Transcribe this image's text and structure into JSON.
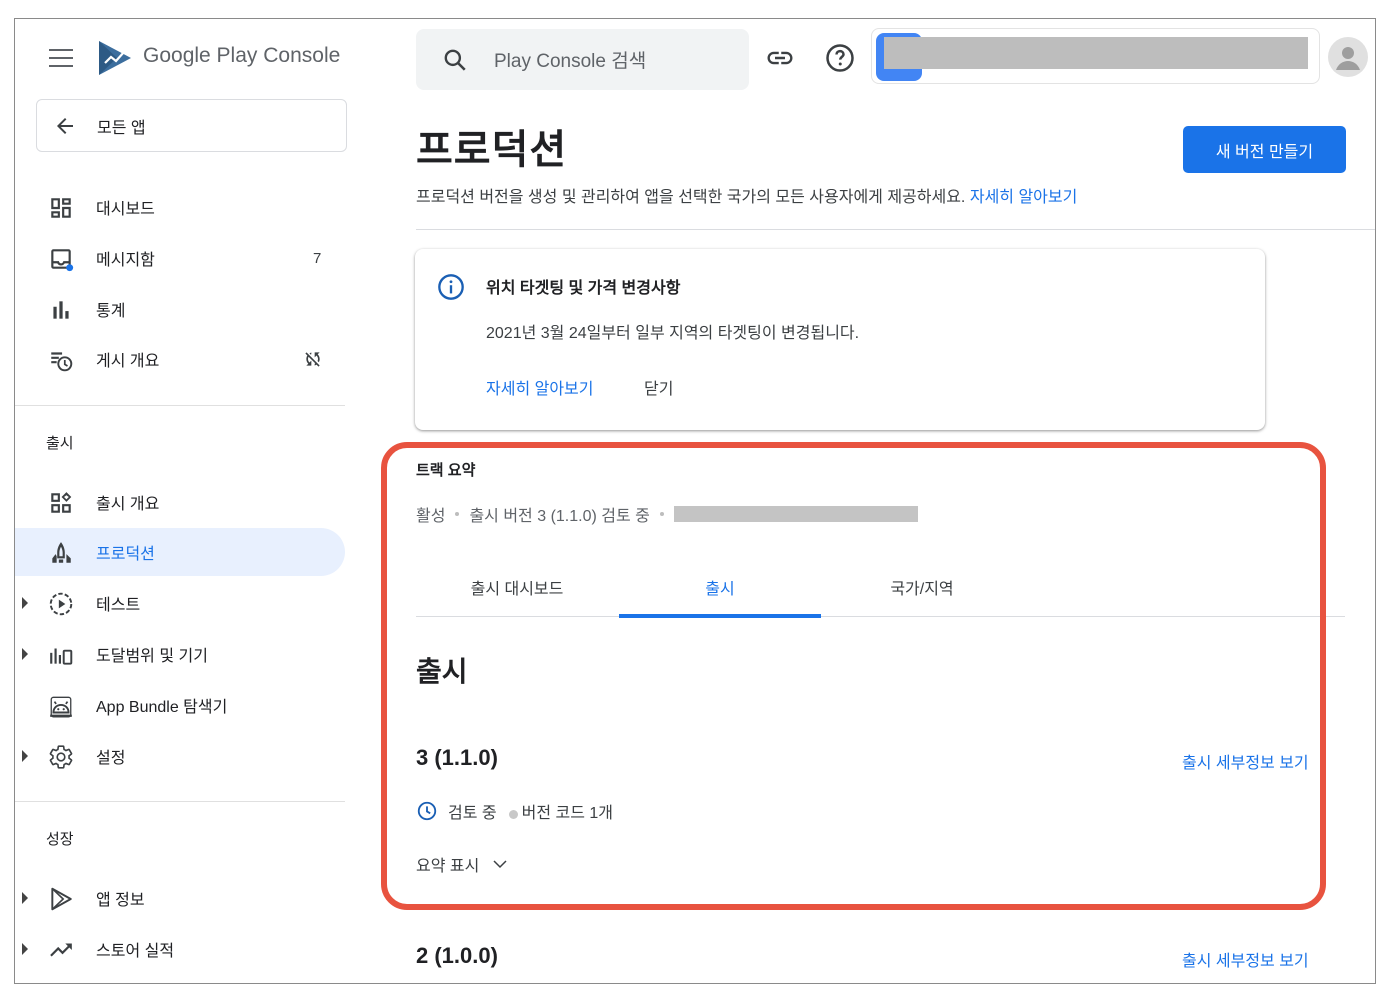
{
  "app": {
    "brand_prefix": "Google Play",
    "brand_suffix": "Console"
  },
  "sidebar": {
    "back_label": "모든 앱",
    "items": [
      {
        "label": "대시보드",
        "icon": "dashboard-icon"
      },
      {
        "label": "메시지함",
        "icon": "inbox-icon",
        "badge": "7"
      },
      {
        "label": "통계",
        "icon": "bar-chart-icon"
      },
      {
        "label": "게시 개요",
        "icon": "publishing-overview-icon",
        "status_icon": "sync-off-icon"
      }
    ],
    "release_section": "출시",
    "release_items": [
      {
        "label": "출시 개요",
        "icon": "release-overview-icon"
      },
      {
        "label": "프로덕션",
        "icon": "rocket-icon",
        "active": true
      },
      {
        "label": "테스트",
        "icon": "play-circle-icon",
        "expandable": true
      },
      {
        "label": "도달범위 및 기기",
        "icon": "devices-chart-icon",
        "expandable": true
      },
      {
        "label": "App Bundle 탐색기",
        "icon": "android-icon"
      },
      {
        "label": "설정",
        "icon": "gear-icon",
        "expandable": true
      }
    ],
    "growth_section": "성장",
    "growth_items": [
      {
        "label": "앱 정보",
        "icon": "play-store-icon",
        "expandable": true
      },
      {
        "label": "스토어 실적",
        "icon": "trending-up-icon",
        "expandable": true
      }
    ]
  },
  "topbar": {
    "search_placeholder": "Play Console 검색",
    "link_icon": "link-icon",
    "help_icon": "help-icon"
  },
  "main": {
    "title": "프로덕션",
    "create_button": "새 버전 만들기",
    "subtitle": "프로덕션 버전을 생성 및 관리하여 앱을 선택한 국가의 모든 사용자에게 제공하세요.",
    "subtitle_link": "자세히 알아보기",
    "notice": {
      "title": "위치 타겟팅 및 가격 변경사항",
      "body": "2021년 3월 24일부터 일부 지역의 타겟팅이 변경됩니다.",
      "learn_more": "자세히 알아보기",
      "dismiss": "닫기"
    },
    "track": {
      "title": "트랙 요약",
      "status_active": "활성",
      "status_release": "출시 버전 3 (1.1.0) 검토 중"
    },
    "tabs": [
      "출시 대시보드",
      "출시",
      "국가/지역"
    ],
    "active_tab": "출시",
    "section_heading": "출시",
    "releases": [
      {
        "version": "3 (1.1.0)",
        "link": "출시 세부정보 보기",
        "status": "검토 중",
        "codes": "버전 코드 1개",
        "summary_toggle": "요약 표시"
      },
      {
        "version": "2 (1.0.0)",
        "link": "출시 세부정보 보기"
      }
    ]
  },
  "colors": {
    "accent": "#1a73e8",
    "highlight": "#e8533f",
    "active_nav_bg": "#e8f0fe"
  }
}
